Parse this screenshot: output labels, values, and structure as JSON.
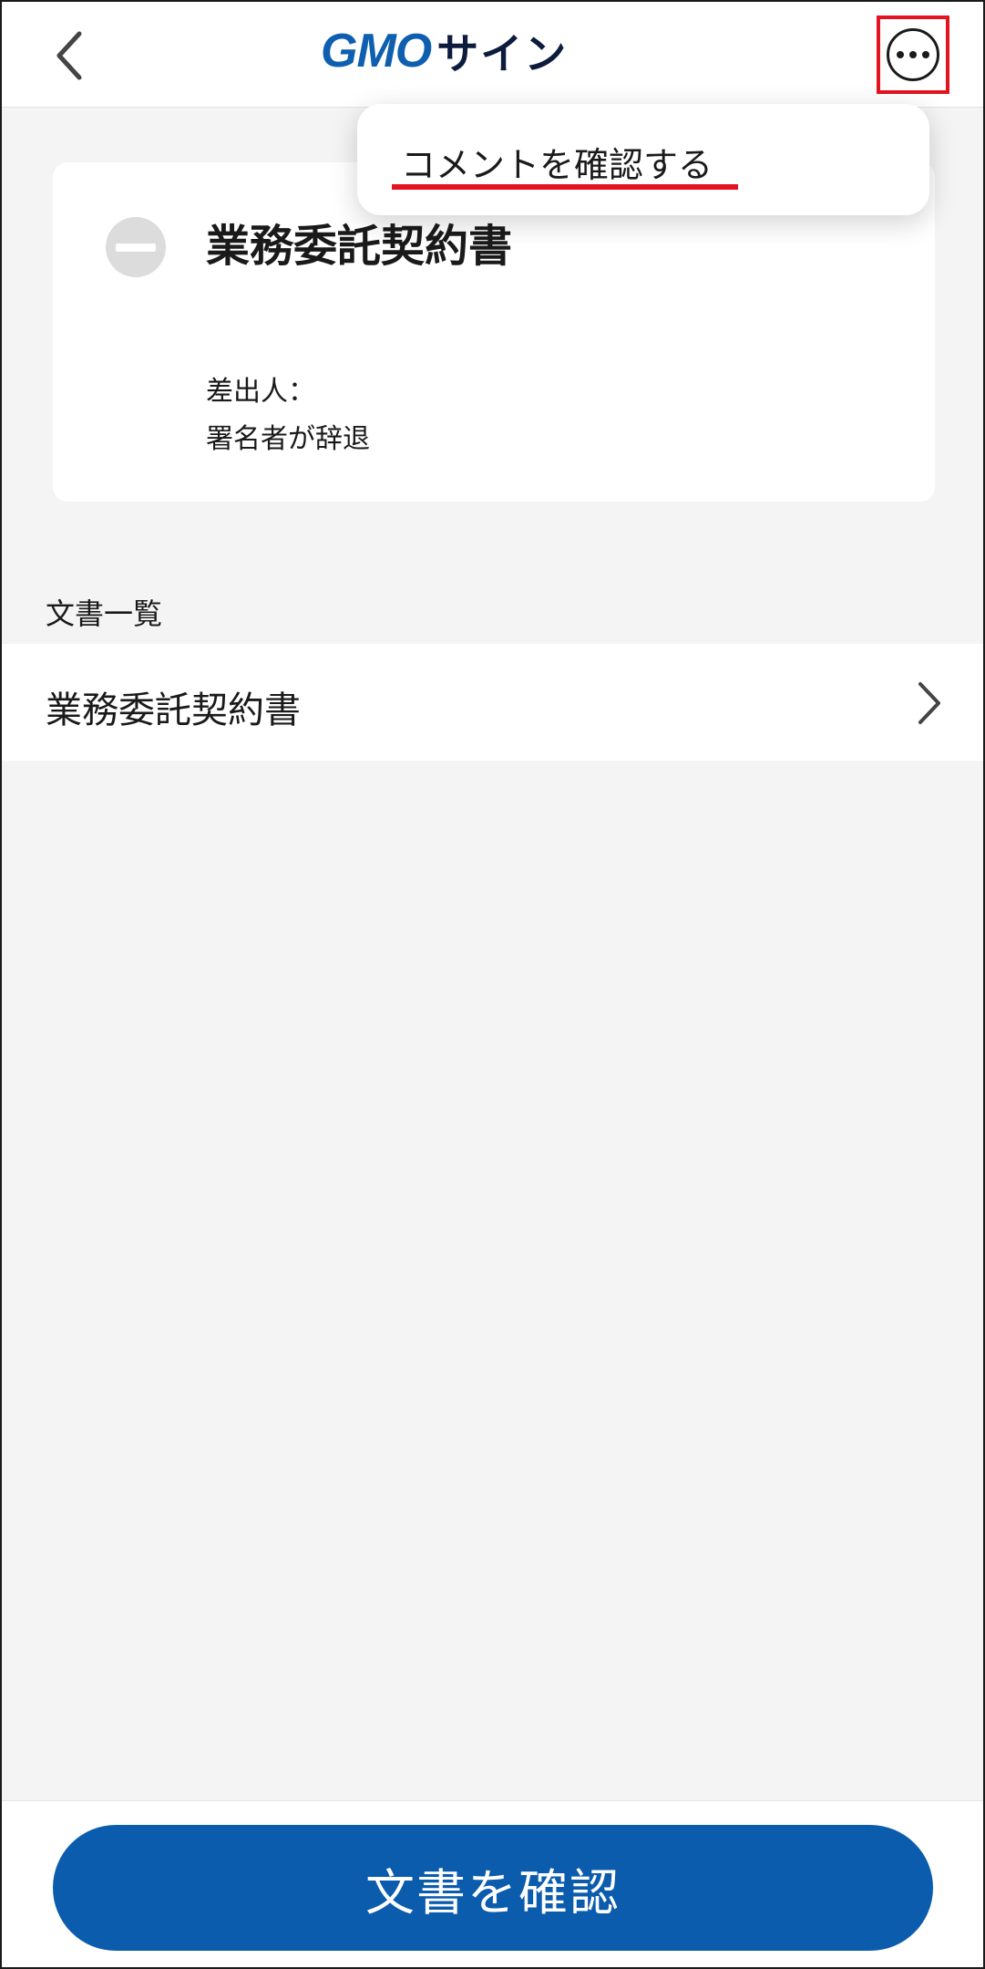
{
  "header": {
    "logo_gmo": "GMO",
    "logo_sign": "サイン"
  },
  "popup": {
    "item_label": "コメントを確認する"
  },
  "document": {
    "title": "業務委託契約書",
    "sender_label": "差出人：",
    "status": "署名者が辞退"
  },
  "documents_section": {
    "label": "文書一覧",
    "items": [
      {
        "label": "業務委託契約書"
      }
    ]
  },
  "footer": {
    "confirm_label": "文書を確認"
  },
  "colors": {
    "brand_blue": "#0b5cad",
    "highlight_red": "#e3141f",
    "background": "#f4f4f4"
  },
  "icons": {
    "back": "chevron-left-icon",
    "more": "more-options-icon",
    "status": "declined-icon",
    "row": "chevron-right-icon"
  }
}
